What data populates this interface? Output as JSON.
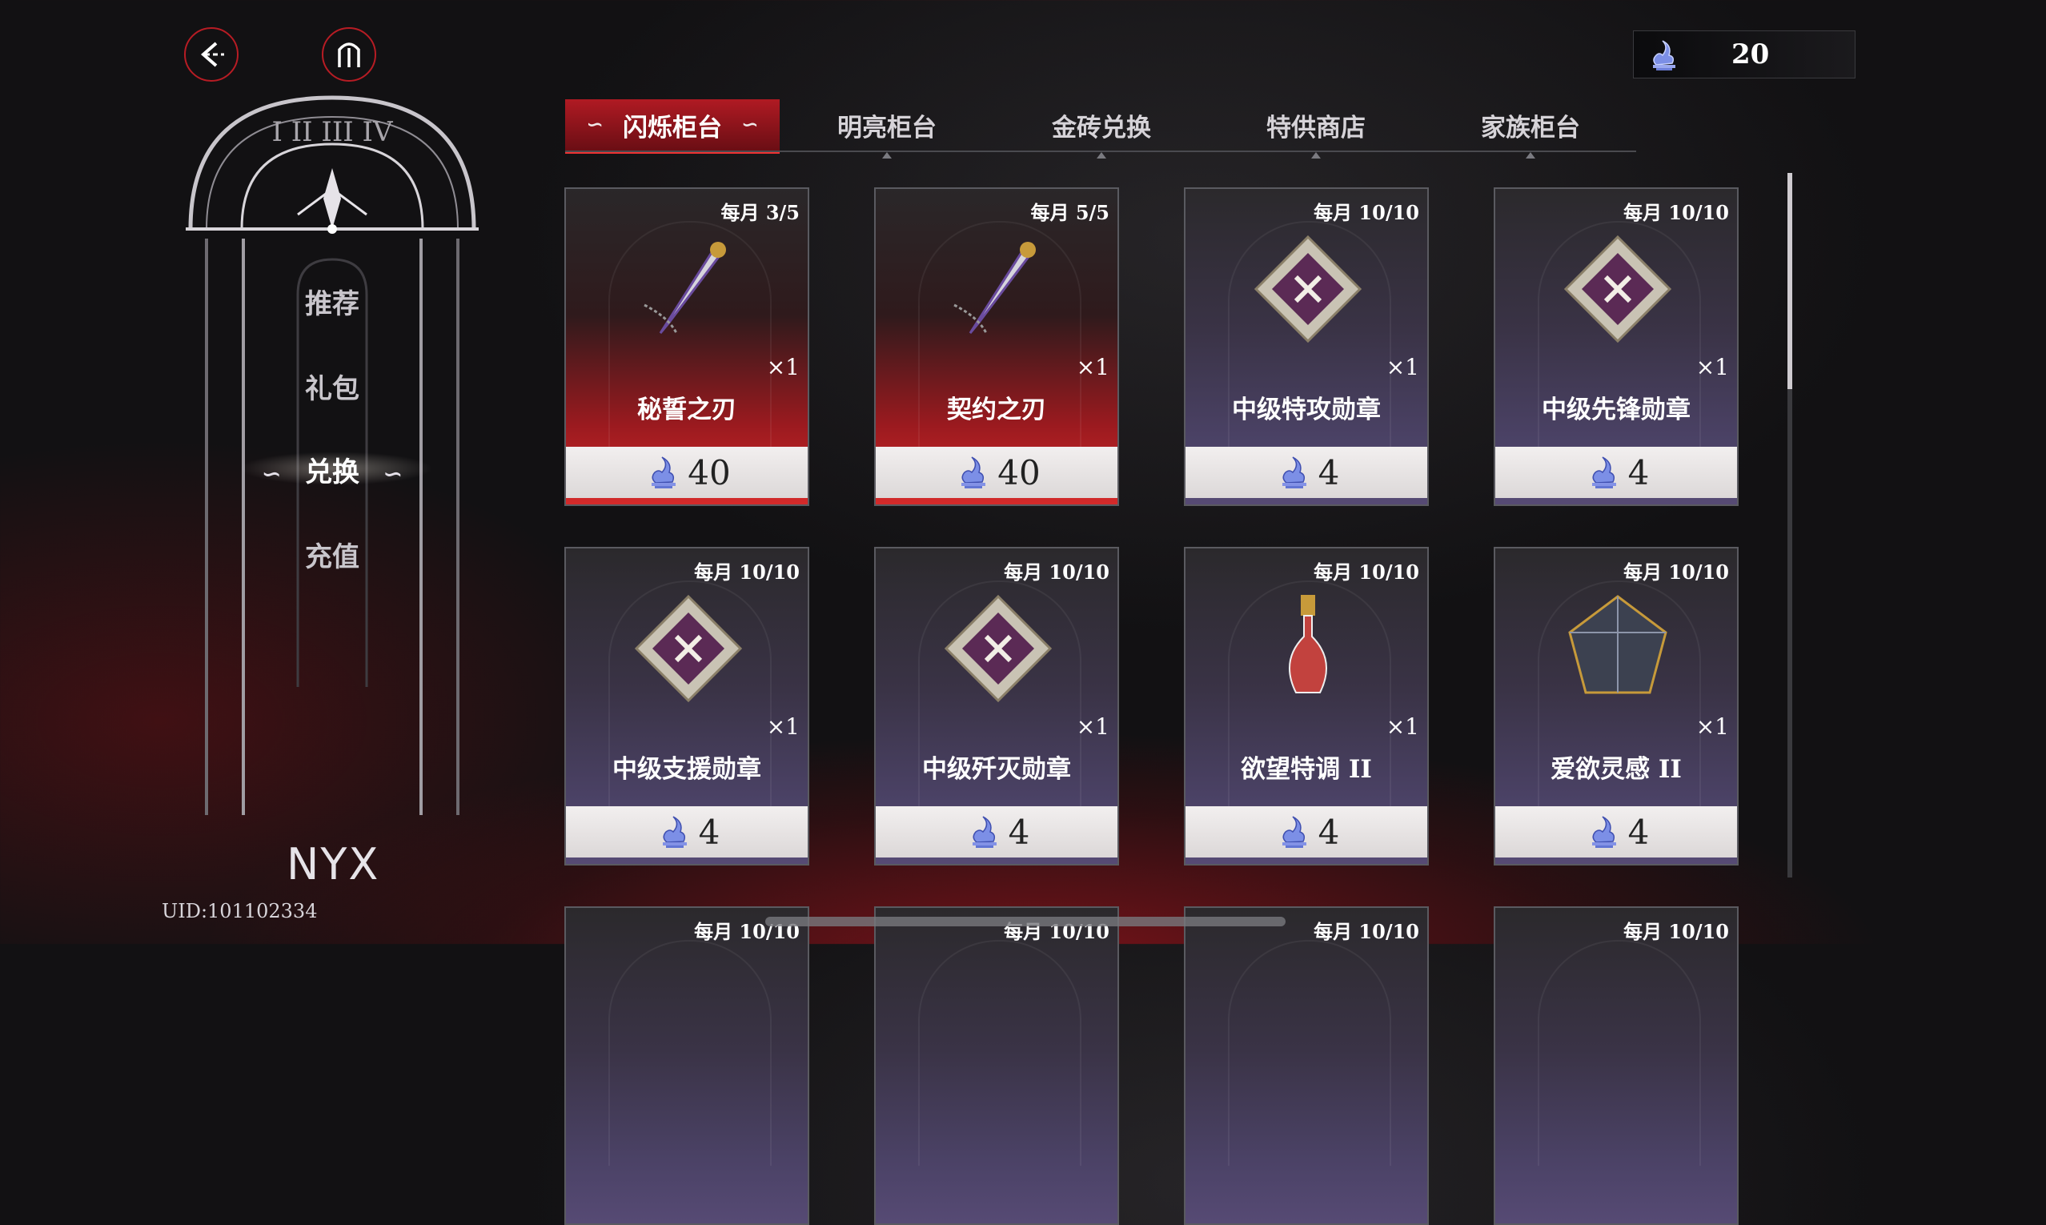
{
  "currency": {
    "amount": "20"
  },
  "side_menu": {
    "items": [
      {
        "label": "推荐"
      },
      {
        "label": "礼包"
      },
      {
        "label": "兑换"
      },
      {
        "label": "充值"
      }
    ],
    "active_index": 2,
    "logo": "NYX",
    "uid": "UID:101102334"
  },
  "tabs": [
    {
      "label": "闪烁柜台"
    },
    {
      "label": "明亮柜台"
    },
    {
      "label": "金砖兑换"
    },
    {
      "label": "特供商店"
    },
    {
      "label": "家族柜台"
    }
  ],
  "active_tab": 0,
  "items": [
    {
      "name": "秘誓之刃",
      "limit": "每月 3/5",
      "qty": "×1",
      "price": "40",
      "theme": "red"
    },
    {
      "name": "契约之刃",
      "limit": "每月 5/5",
      "qty": "×1",
      "price": "40",
      "theme": "red"
    },
    {
      "name": "中级特攻勋章",
      "limit": "每月 10/10",
      "qty": "×1",
      "price": "4",
      "theme": "purple"
    },
    {
      "name": "中级先锋勋章",
      "limit": "每月 10/10",
      "qty": "×1",
      "price": "4",
      "theme": "purple"
    },
    {
      "name": "中级支援勋章",
      "limit": "每月 10/10",
      "qty": "×1",
      "price": "4",
      "theme": "purple"
    },
    {
      "name": "中级歼灭勋章",
      "limit": "每月 10/10",
      "qty": "×1",
      "price": "4",
      "theme": "purple"
    },
    {
      "name": "欲望特调 II",
      "limit": "每月 10/10",
      "qty": "×1",
      "price": "4",
      "theme": "purple"
    },
    {
      "name": "爱欲灵感 II",
      "limit": "每月 10/10",
      "qty": "×1",
      "price": "4",
      "theme": "purple"
    },
    {
      "name": "",
      "limit": "每月 10/10",
      "qty": "",
      "price": "",
      "theme": "dark"
    },
    {
      "name": "",
      "limit": "每月 10/10",
      "qty": "",
      "price": "",
      "theme": "dark"
    },
    {
      "name": "",
      "limit": "每月 10/10",
      "qty": "",
      "price": "",
      "theme": "dark"
    },
    {
      "name": "",
      "limit": "每月 10/10",
      "qty": "",
      "price": "",
      "theme": "dark"
    }
  ],
  "icons": {
    "back": "back-arrow-icon",
    "home": "home-icon",
    "currency": "lamp-currency-icon"
  },
  "colors": {
    "accent": "#b01a23",
    "card_red": "#d42a2a",
    "card_purple": "#564a74"
  }
}
